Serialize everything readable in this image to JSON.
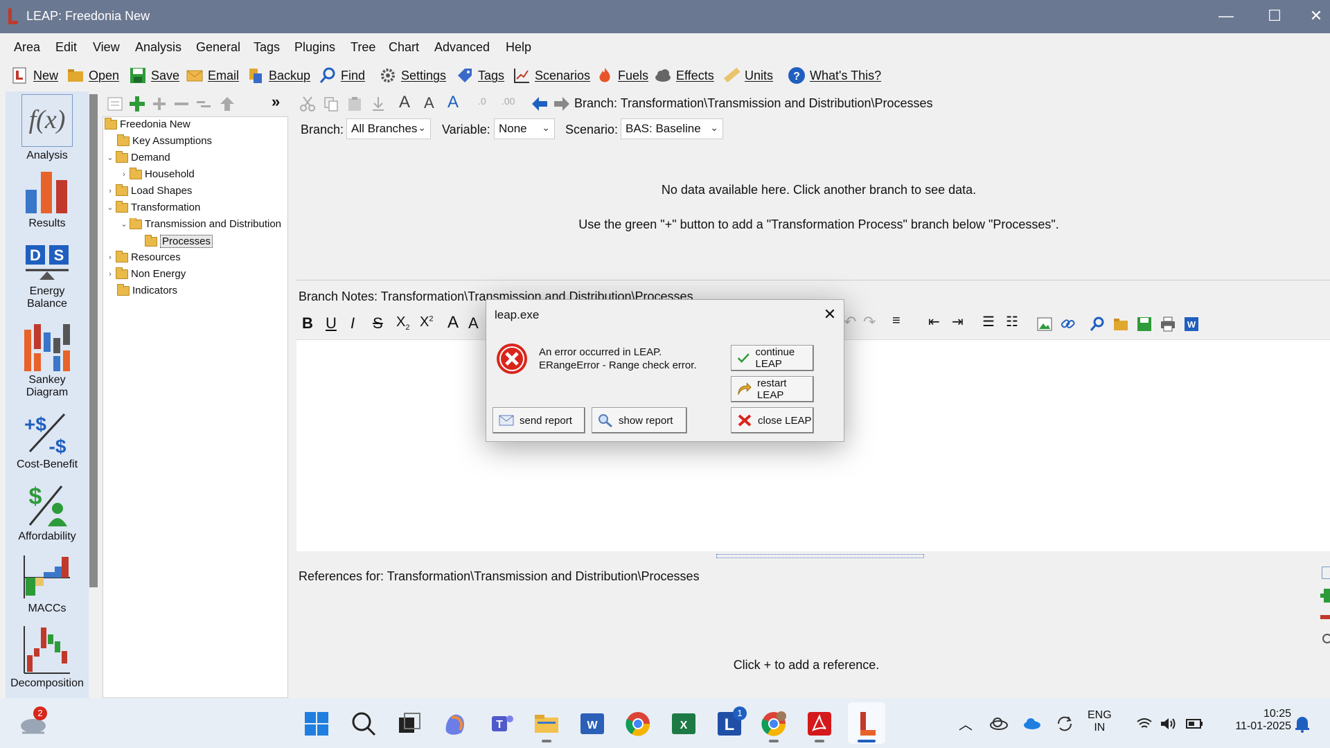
{
  "window": {
    "title": "LEAP: Freedonia New",
    "minimize": "—",
    "maximize": "☐",
    "close": "✕"
  },
  "menu": [
    "Area",
    "Edit",
    "View",
    "Analysis",
    "General",
    "Tags",
    "Plugins",
    "Tree",
    "Chart",
    "Advanced",
    "Help"
  ],
  "toolbar": {
    "new": "New",
    "open": "Open",
    "save": "Save",
    "email": "Email",
    "backup": "Backup",
    "find": "Find",
    "settings": "Settings",
    "tags": "Tags",
    "scenarios": "Scenarios",
    "fuels": "Fuels",
    "effects": "Effects",
    "units": "Units",
    "whats_this": "What's This?"
  },
  "sidebar": {
    "analysis": "Analysis",
    "results": "Results",
    "energy_balance_1": "Energy",
    "energy_balance_2": "Balance",
    "sankey_1": "Sankey",
    "sankey_2": "Diagram",
    "cost_benefit": "Cost-Benefit",
    "affordability": "Affordability",
    "maccs": "MACCs",
    "decomposition": "Decomposition",
    "fx": "f(x)",
    "d": "D",
    "s": "S"
  },
  "tree": {
    "more": "»",
    "root": "Freedonia New",
    "key_assumptions": "Key Assumptions",
    "demand": "Demand",
    "household": "Household",
    "load_shapes": "Load Shapes",
    "transformation": "Transformation",
    "tnd": "Transmission and Distribution",
    "processes": "Processes",
    "resources": "Resources",
    "non_energy": "Non Energy",
    "indicators": "Indicators"
  },
  "breadcrumb": "Branch: Transformation\\Transmission and Distribution\\Processes",
  "filters": {
    "branch_label": "Branch:",
    "branch_value": "All Branches",
    "variable_label": "Variable:",
    "variable_value": "None",
    "scenario_label": "Scenario:",
    "scenario_value": "BAS: Baseline"
  },
  "data_area": {
    "msg1": "No data available here. Click another branch to see data.",
    "msg2": "Use the green \"+\" button to add a \"Transformation Process\" branch below \"Processes\"."
  },
  "notes": {
    "title": "Branch Notes: Transformation\\Transmission and Distribution\\Processes"
  },
  "refs": {
    "title": "References for: Transformation\\Transmission and Distribution\\Processes",
    "hint": "Click + to add a reference."
  },
  "dialog": {
    "title": "leap.exe",
    "line1": "An error occurred in LEAP.",
    "line2": "ERangeError - Range check error.",
    "continue": "continue LEAP",
    "restart": "restart LEAP",
    "close": "close LEAP",
    "send_report": "send report",
    "show_report": "show report"
  },
  "taskbar": {
    "weather_badge": "2",
    "leap_badge": "1",
    "lang1": "ENG",
    "lang2": "IN",
    "time": "10:25",
    "date": "11-01-2025"
  },
  "colors": {
    "titlebar": "#6b7891",
    "accent": "#1f5fbf",
    "error": "#d9261c",
    "green": "#2e9b3a"
  }
}
